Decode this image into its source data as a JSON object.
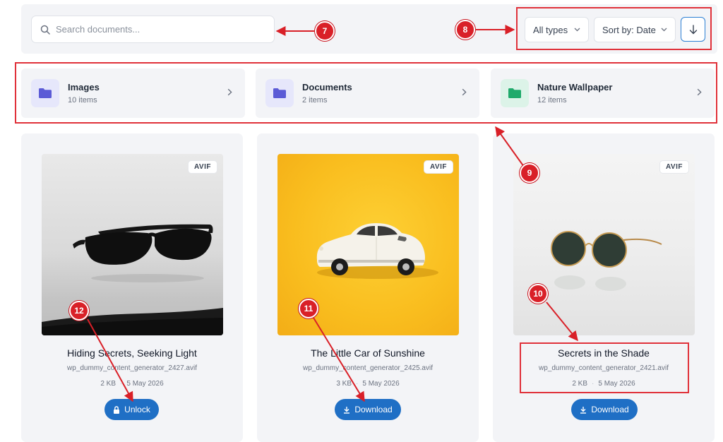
{
  "search": {
    "placeholder": "Search documents..."
  },
  "filters": {
    "type_label": "All types",
    "sort_label": "Sort by: Date"
  },
  "folders": [
    {
      "name": "Images",
      "count": "10 items",
      "color": "#5b5bd6",
      "bg": "#e6e7fb"
    },
    {
      "name": "Documents",
      "count": "2 items",
      "color": "#5b5bd6",
      "bg": "#e6e7fb"
    },
    {
      "name": "Nature Wallpaper",
      "count": "12 items",
      "color": "#1faa6b",
      "bg": "#dcf3e8"
    }
  ],
  "cards": [
    {
      "badge": "AVIF",
      "title": "Hiding Secrets, Seeking Light",
      "file": "wp_dummy_content_generator_2427.avif",
      "size": "2 KB",
      "date": "5 May 2026",
      "action": "Unlock",
      "action_icon": "lock-icon"
    },
    {
      "badge": "AVIF",
      "title": "The Little Car of Sunshine",
      "file": "wp_dummy_content_generator_2425.avif",
      "size": "3 KB",
      "date": "5 May 2026",
      "action": "Download",
      "action_icon": "download-icon"
    },
    {
      "badge": "AVIF",
      "title": "Secrets in the Shade",
      "file": "wp_dummy_content_generator_2421.avif",
      "size": "2 KB",
      "date": "5 May 2026",
      "action": "Download",
      "action_icon": "download-icon"
    }
  ],
  "annotations": {
    "a7": "7",
    "a8": "8",
    "a9": "9",
    "a10": "10",
    "a11": "11",
    "a12": "12"
  },
  "colors": {
    "accent": "#1f6fc5",
    "annotation": "#d92028"
  }
}
